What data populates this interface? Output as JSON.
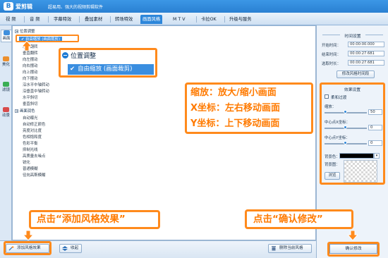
{
  "app": {
    "icon_glyph": "B",
    "name": "爱剪辑",
    "slogan": "超易用、强大的视频剪辑软件"
  },
  "menu": [
    "视 频",
    "音 频",
    "字幕特效",
    "叠加素材",
    "转场特效",
    "画面风格",
    "M T V",
    "卡拉OK",
    "升级与服务"
  ],
  "left_tabs": [
    {
      "label": "画面",
      "icon": "picture-icon",
      "color": "#3f8fdd"
    },
    {
      "label": "美化",
      "icon": "wand-icon",
      "color": "#ec8f2d"
    },
    {
      "label": "滤镜",
      "icon": "filter-icon",
      "color": "#3aae54"
    },
    {
      "label": "动景",
      "icon": "motion-icon",
      "color": "#d84b4b"
    }
  ],
  "tree": {
    "group1": "位置调整",
    "selected": "自由缩放 (画面裁剪)",
    "items1": [
      "水平翻转",
      "垂直翻转",
      "向左摆动",
      "向右摆动",
      "向上摆动",
      "向下摆动",
      "沿水平中轴转动",
      "沿垂直中轴转动",
      "水平斜切",
      "垂直斜切"
    ],
    "group2": "画面润色",
    "items2": [
      "自动曝光",
      "自动修正颜色",
      "亮度对比度",
      "色相饱和度",
      "色彩平衡",
      "抑制光线",
      "高质量去噪点",
      "锐化",
      "普通模糊",
      "径向高斯模糊"
    ]
  },
  "zoom_popup": {
    "header": "位置调整",
    "item": "自由缩放 (画面裁剪)"
  },
  "callouts": {
    "effect_lines": [
      "缩放：放大/缩小画面",
      "X坐标：左右移动画面",
      "Y坐标：上下移动画面"
    ],
    "add_effect": "点击“添加风格效果”",
    "confirm": "点击“确认修改”"
  },
  "time_settings": {
    "title": "时间设置",
    "start_label": "开始时间：",
    "start_value": "00:00:00.000",
    "end_label": "结束时间：",
    "end_value": "00:00:27.681",
    "duration_label": "选取时长：",
    "duration_value": "00:00:27.681",
    "adjust_button": "修改风格时间段"
  },
  "effect_settings": {
    "title": "效果设置",
    "soft_transition": "柔和过渡",
    "zoom_label": "缩放：",
    "zoom_value": "50",
    "zoom_level": 0.5,
    "x_label": "中心点X坐标：",
    "x_value": "0",
    "x_level": 0.5,
    "y_label": "中心点Y坐标：",
    "y_value": "0",
    "y_level": 0.5,
    "bg_color_label": "背景色：",
    "bg_color": "#000000",
    "bg_image_label": "背景图：",
    "browse_button": "浏览"
  },
  "bottom": {
    "add_effect": "添加风格效果",
    "collapse": "收起",
    "delete_current": "删除当前风格"
  },
  "confirm_button": "确认修改",
  "colors": {
    "accent": "#ff8a1c",
    "selection": "#3a8ee0",
    "titlebar": "#2a80d2"
  }
}
